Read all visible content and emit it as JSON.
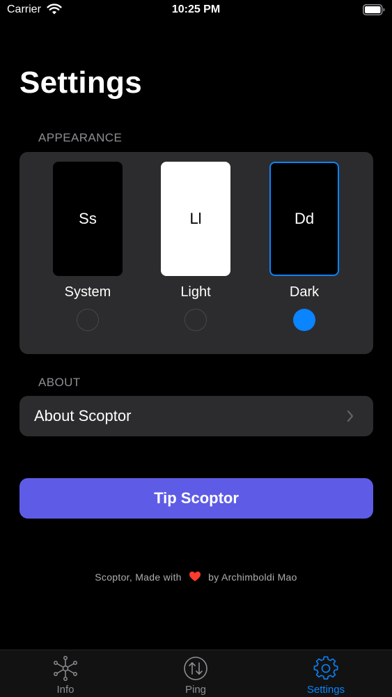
{
  "status_bar": {
    "carrier": "Carrier",
    "time": "10:25 PM",
    "wifi_icon": "wifi-icon",
    "battery_icon": "battery-icon"
  },
  "page": {
    "title": "Settings"
  },
  "appearance": {
    "header": "APPEARANCE",
    "options": [
      {
        "thumb_text": "Ss",
        "label": "System",
        "selected": false
      },
      {
        "thumb_text": "Ll",
        "label": "Light",
        "selected": false
      },
      {
        "thumb_text": "Dd",
        "label": "Dark",
        "selected": true
      }
    ]
  },
  "about": {
    "header": "ABOUT",
    "row_label": "About Scoptor",
    "chevron_icon": "chevron-right-icon"
  },
  "tip_button": {
    "label": "Tip Scoptor"
  },
  "footer": {
    "prefix": "Scoptor, Made with",
    "heart_icon": "heart-icon",
    "suffix": "by Archimboldi Mao"
  },
  "tab_bar": {
    "tabs": [
      {
        "label": "Info",
        "icon": "network-icon",
        "active": false
      },
      {
        "label": "Ping",
        "icon": "up-down-arrows-icon",
        "active": false
      },
      {
        "label": "Settings",
        "icon": "gear-icon",
        "active": true
      }
    ]
  },
  "colors": {
    "background": "#000000",
    "card": "#2c2c2e",
    "accent": "#0a84ff",
    "tip_button": "#5e5ce6",
    "secondary_text": "#8e8e93"
  }
}
